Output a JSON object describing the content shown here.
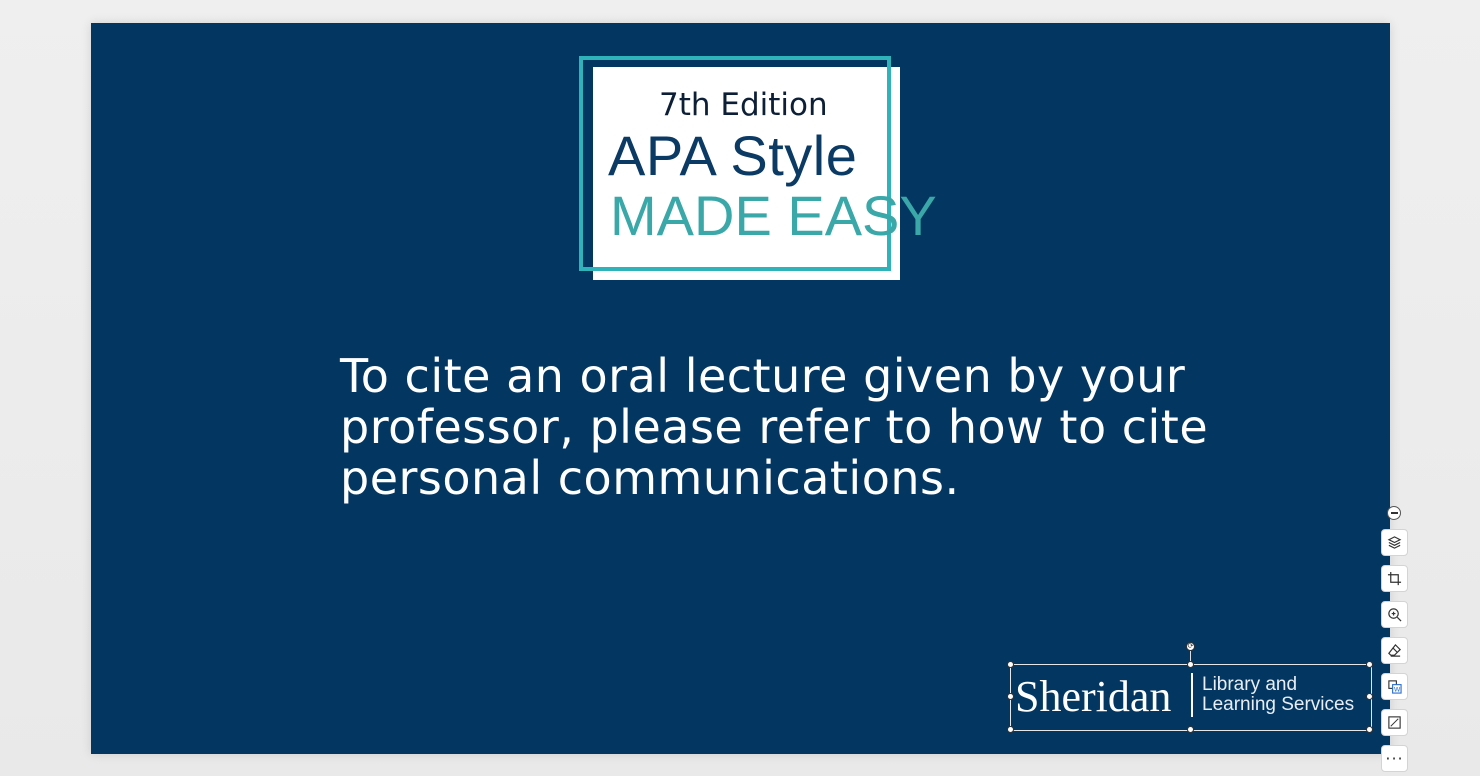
{
  "slide": {
    "title_card": {
      "edition": "7th Edition",
      "title": "APA Style",
      "subtitle": "MADE EASY"
    },
    "body_lines": [
      "To cite an oral lecture given by your",
      "professor, please refer to how to cite",
      "personal communications."
    ],
    "logo": {
      "name": "Sheridan",
      "sub_line1": "Library and",
      "sub_line2": "Learning Services"
    }
  },
  "colors": {
    "slide_bg": "#033761",
    "accent_teal": "#2fb3bb",
    "title_navy": "#0b3a64",
    "subtitle_teal": "#3aa7a9"
  },
  "toolbar": {
    "collapse": "collapse-icon",
    "buttons": [
      "layers-icon",
      "crop-icon",
      "zoom-in-icon",
      "eraser-icon",
      "convert-to-word-icon",
      "edit-image-icon",
      "more-icon"
    ]
  }
}
